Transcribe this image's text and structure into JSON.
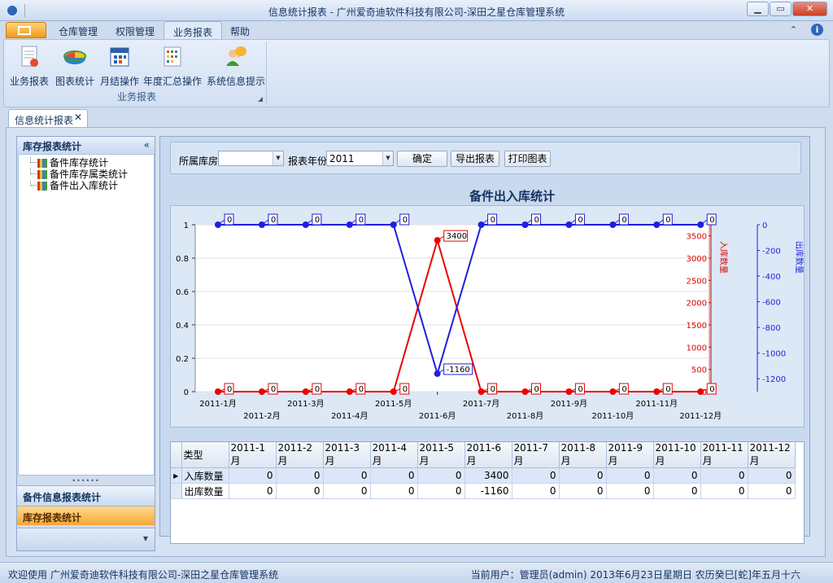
{
  "window": {
    "title": "信息统计报表 - 广州爱奇迪软件科技有限公司-深田之星仓库管理系统"
  },
  "ribbon": {
    "tabs": [
      "仓库管理",
      "权限管理",
      "业务报表",
      "帮助"
    ],
    "active_tab": "业务报表",
    "buttons": [
      "业务报表",
      "图表统计",
      "月结操作",
      "年度汇总操作",
      "系统信息提示"
    ],
    "group": "业务报表"
  },
  "doc_tab": {
    "label": "信息统计报表"
  },
  "left_panel": {
    "header": "库存报表统计",
    "tree": [
      "备件库存统计",
      "备件库存属类统计",
      "备件出入库统计"
    ],
    "nav": [
      {
        "label": "备件信息报表统计",
        "active": false
      },
      {
        "label": "库存报表统计",
        "active": true
      }
    ]
  },
  "filters": {
    "warehouse_label": "所属库房",
    "warehouse_value": "",
    "year_label": "报表年份",
    "year_value": "2011",
    "ok": "确定",
    "export": "导出报表",
    "print": "打印图表"
  },
  "chart_data": {
    "type": "line",
    "title": "备件出入库统计",
    "x": [
      "2011-1月",
      "2011-2月",
      "2011-3月",
      "2011-4月",
      "2011-5月",
      "2011-6月",
      "2011-7月",
      "2011-8月",
      "2011-9月",
      "2011-10月",
      "2011-11月",
      "2011-12月"
    ],
    "series": [
      {
        "name": "入库数量",
        "values": [
          0,
          0,
          0,
          0,
          0,
          3400,
          0,
          0,
          0,
          0,
          0,
          0
        ],
        "color": "#ee0000",
        "axis": "right1"
      },
      {
        "name": "出库数量",
        "values": [
          0,
          0,
          0,
          0,
          0,
          -1160,
          0,
          0,
          0,
          0,
          0,
          0
        ],
        "color": "#1f1fe0",
        "axis": "right2"
      }
    ],
    "left_axis_ticks": [
      "0",
      "0.2",
      "0.4",
      "0.6",
      "0.8",
      "1"
    ],
    "right1_ticks": [
      "0",
      "500",
      "1000",
      "1500",
      "2000",
      "2500",
      "3000",
      "3500"
    ],
    "right1_ylim": [
      0,
      3750
    ],
    "right2_ticks": [
      "0",
      "-200",
      "-400",
      "-600",
      "-800",
      "-1000",
      "-1200"
    ],
    "right2_ylim": [
      -1300,
      0
    ],
    "right1_label": "入库数量",
    "right2_label": "出库数量"
  },
  "table": {
    "headers": [
      "类型",
      "2011-1月",
      "2011-2月",
      "2011-3月",
      "2011-4月",
      "2011-5月",
      "2011-6月",
      "2011-7月",
      "2011-8月",
      "2011-9月",
      "2011-10月",
      "2011-11月",
      "2011-12月"
    ],
    "rows": [
      [
        "入库数量",
        "0",
        "0",
        "0",
        "0",
        "0",
        "3400",
        "0",
        "0",
        "0",
        "0",
        "0",
        "0"
      ],
      [
        "出库数量",
        "0",
        "0",
        "0",
        "0",
        "0",
        "-1160",
        "0",
        "0",
        "0",
        "0",
        "0",
        "0"
      ]
    ]
  },
  "status": {
    "left": "欢迎使用 广州爱奇迪软件科技有限公司-深田之星仓库管理系统",
    "right": "当前用户：管理员(admin)   2013年6月23日星期日 农历癸巳[蛇]年五月十六"
  }
}
